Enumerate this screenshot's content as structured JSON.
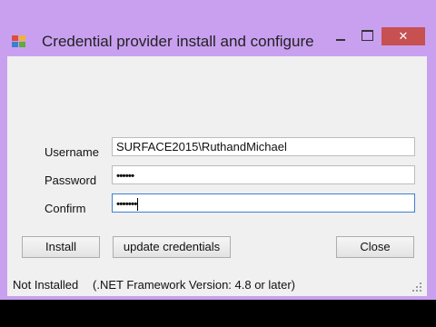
{
  "window": {
    "title": "Credential provider install and configure",
    "minimize_glyph": "",
    "maximize_glyph": "",
    "close_glyph": "✕",
    "icon": "app-icon"
  },
  "form": {
    "username_label": "Username",
    "password_label": "Password",
    "confirm_label": "Confirm",
    "username_value": "SURFACE2015\\RuthandMichael",
    "password_value": "••••••",
    "confirm_value": "•••••••"
  },
  "buttons": {
    "install": "Install",
    "update_credentials": "update credentials",
    "close": "Close"
  },
  "status": {
    "install_state": "Not Installed",
    "framework": "(.NET Framework Version: 4.8 or later)"
  },
  "colors": {
    "window_frame": "#c9a0f0",
    "close_button": "#c75050",
    "client_background": "#f0f0f0"
  }
}
